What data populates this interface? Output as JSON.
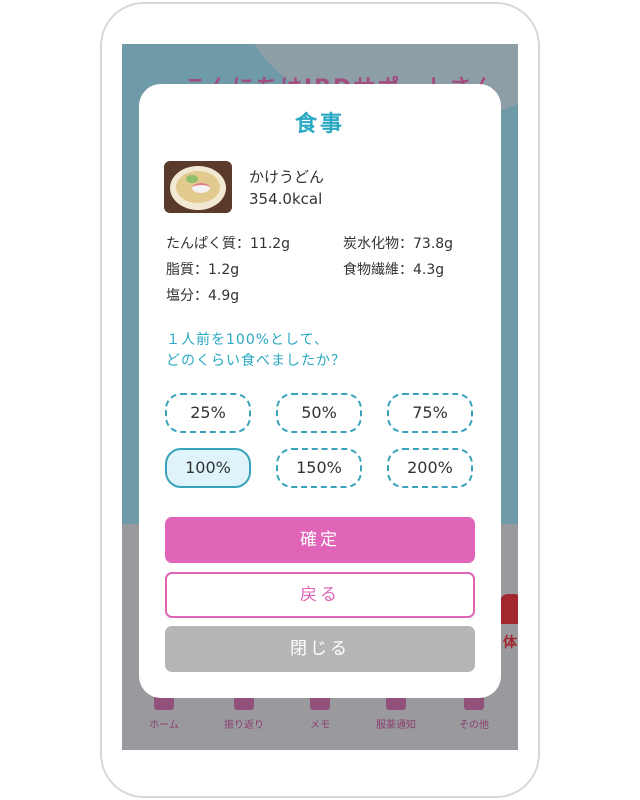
{
  "background": {
    "title": "こんにちはIBDサポートさん",
    "side_label": "体",
    "tabs": [
      {
        "label": "ホーム",
        "icon": "home-icon"
      },
      {
        "label": "振り返り",
        "icon": "calendar-icon"
      },
      {
        "label": "メモ",
        "icon": "memo-icon"
      },
      {
        "label": "服薬通知",
        "icon": "pill-icon"
      },
      {
        "label": "その他",
        "icon": "list-icon"
      }
    ]
  },
  "modal": {
    "title": "食事",
    "food": {
      "name": "かけうどん",
      "kcal": "354.0kcal",
      "image_icon": "udon-image"
    },
    "nutrients": [
      "たんぱく質：11.2g",
      "炭水化物：73.8g",
      "脂質：1.2g",
      "食物繊維：4.3g",
      "塩分：4.9g"
    ],
    "question_line1": "１人前を100%として、",
    "question_line2": "どのくらい食べましたか？",
    "options": [
      "25%",
      "50%",
      "75%",
      "100%",
      "150%",
      "200%"
    ],
    "selected_option": "100%",
    "buttons": {
      "confirm": "確定",
      "back": "戻る",
      "close": "閉じる"
    }
  },
  "colors": {
    "accent_teal": "#2aa8c4",
    "accent_pink": "#e065b8",
    "close_gray": "#b5b5b5",
    "selected_fill": "#dff4fa"
  }
}
